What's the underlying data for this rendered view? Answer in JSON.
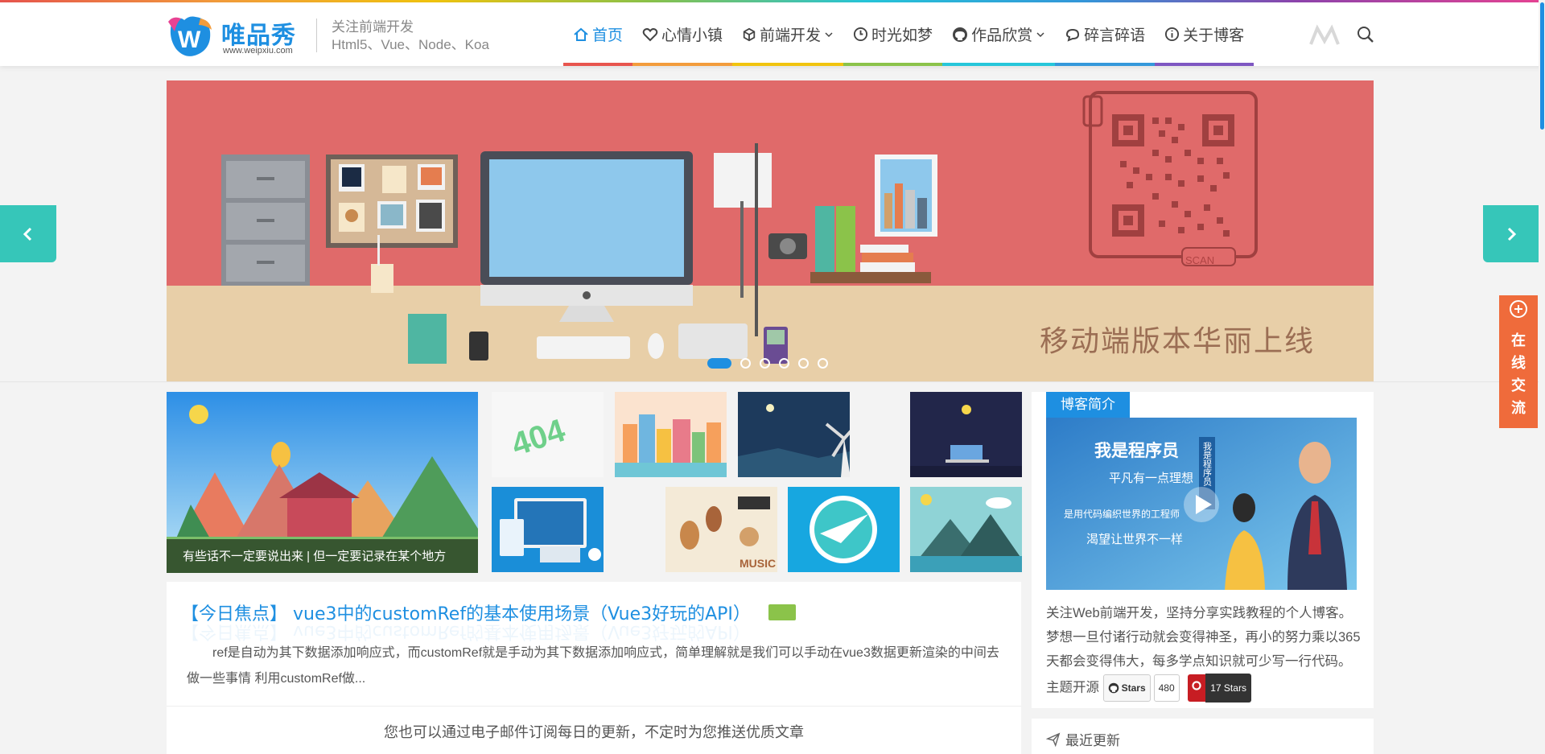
{
  "colors": {
    "accent": "#1e8fe1",
    "teal": "#36c6b9",
    "orange": "#ef6b3b",
    "banner_red": "#e06a6a",
    "banner_sand": "#e8cfa8"
  },
  "header": {
    "logo_text": "唯品秀",
    "logo_url": "www.weipxiu.com",
    "tagline_line1": "关注前端开发",
    "tagline_line2": "Html5、Vue、Node、Koa",
    "nav": [
      {
        "label": "首页",
        "icon": "home-icon",
        "active": true,
        "dropdown": false
      },
      {
        "label": "心情小镇",
        "icon": "heart-icon",
        "active": false,
        "dropdown": false
      },
      {
        "label": "前端开发",
        "icon": "cube-icon",
        "active": false,
        "dropdown": true
      },
      {
        "label": "时光如梦",
        "icon": "clock-icon",
        "active": false,
        "dropdown": false
      },
      {
        "label": "作品欣赏",
        "icon": "github-icon",
        "active": false,
        "dropdown": true
      },
      {
        "label": "碎言碎语",
        "icon": "chat-icon",
        "active": false,
        "dropdown": false
      },
      {
        "label": "关于博客",
        "icon": "info-icon",
        "active": false,
        "dropdown": false
      }
    ]
  },
  "banner": {
    "text": "移动端版本华丽上线",
    "scan_label": "SCAN",
    "slide_count": 6,
    "active_slide": 0
  },
  "thumbs": {
    "main_caption": "有些话不一定要说出来 | 但一定要记录在某个地方"
  },
  "featured": {
    "title": "【今日焦点】 vue3中的customRef的基本使用场景（Vue3好玩的API）",
    "excerpt": "ref是自动为其下数据添加响应式，而customRef就是手动为其下数据添加响应式，简单理解就是我们可以手动在vue3数据更新渲染的中间去做一些事情 利用customRef做...",
    "subscribe": "您也可以通过电子邮件订阅每日的更新，不定时为您推送优质文章"
  },
  "sidebar": {
    "intro_tag": "博客简介",
    "intro_image_title": "我是程序员",
    "intro_image_sub": "平凡有一点理想",
    "intro_image_line3": "是用代码编织世界的工程师",
    "intro_image_line4": "渴望让世界不一样",
    "intro_image_vertical": "我是程序员",
    "description": "关注Web前端开发，坚持分享实践教程的个人博客。梦想一旦付诸行动就会变得神圣，再小的努力乘以365天都会变得伟大，每多学点知识就可少写一行代码。主题开源",
    "github_label": "Stars",
    "github_count": "480",
    "gitee_label": "17 Stars",
    "recent_title": "最近更新"
  },
  "chat": {
    "label_chars": [
      "在",
      "线",
      "交",
      "流"
    ]
  }
}
